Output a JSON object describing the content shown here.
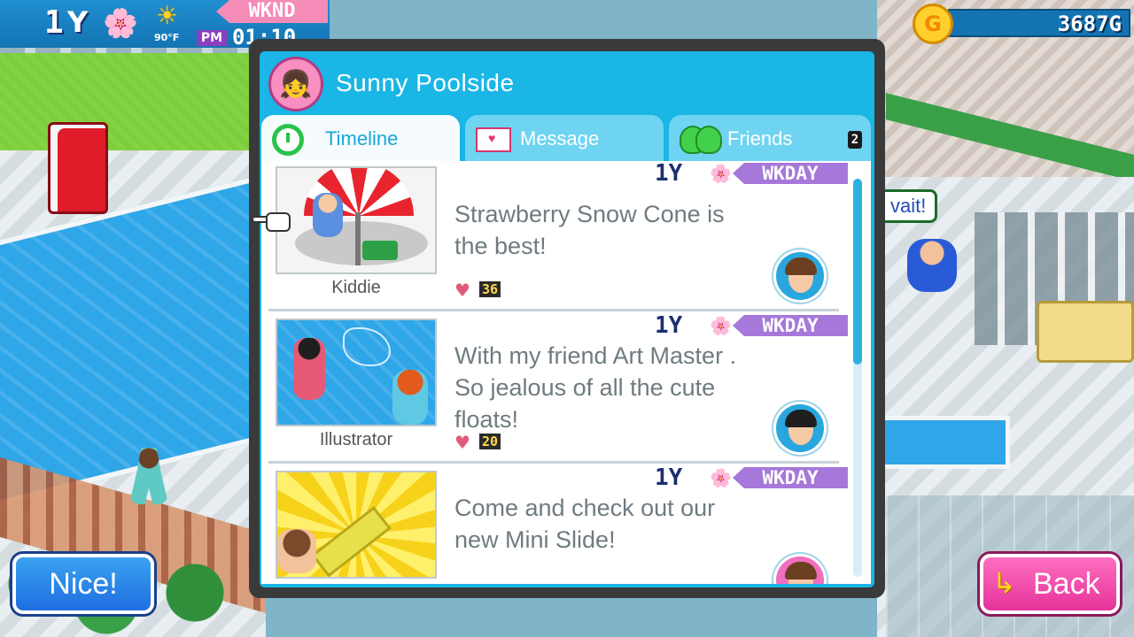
{
  "hud": {
    "year": "1",
    "year_unit": "Y",
    "season_icon": "blossom-icon",
    "weather_icon": "sun-icon",
    "temperature": "90°F",
    "day_type": "WKND",
    "ampm": "PM",
    "clock": "01:10",
    "money": "3687G",
    "coin_letter": "G"
  },
  "scene": {
    "speech_bubble": "vait!"
  },
  "modal": {
    "title": "Sunny Poolside",
    "tabs": [
      {
        "label": "Timeline",
        "icon": "clock-icon",
        "active": true
      },
      {
        "label": "Message",
        "icon": "mail-icon",
        "active": false
      },
      {
        "label": "Friends",
        "icon": "friends-icon",
        "active": false,
        "badge": "2"
      }
    ],
    "posts": [
      {
        "year": "1",
        "year_unit": "Y",
        "day_type": "WKDAY",
        "text": "Strawberry Snow Cone is the best!",
        "author": "Kiddie",
        "likes": "36"
      },
      {
        "year": "1",
        "year_unit": "Y",
        "day_type": "WKDAY",
        "text": "With my friend Art Master . So jealous of all the cute floats!",
        "author": "Illustrator",
        "likes": "20"
      },
      {
        "year": "1",
        "year_unit": "Y",
        "day_type": "WKDAY",
        "text": "Come and check out our new Mini Slide!",
        "author": "",
        "likes": ""
      }
    ]
  },
  "buttons": {
    "nice": "Nice!",
    "back": "Back"
  },
  "colors": {
    "modal_header": "#19b6e6",
    "day_badge": "#a678d9",
    "nice_button": "#1f6ee0",
    "back_button": "#e5329a"
  }
}
